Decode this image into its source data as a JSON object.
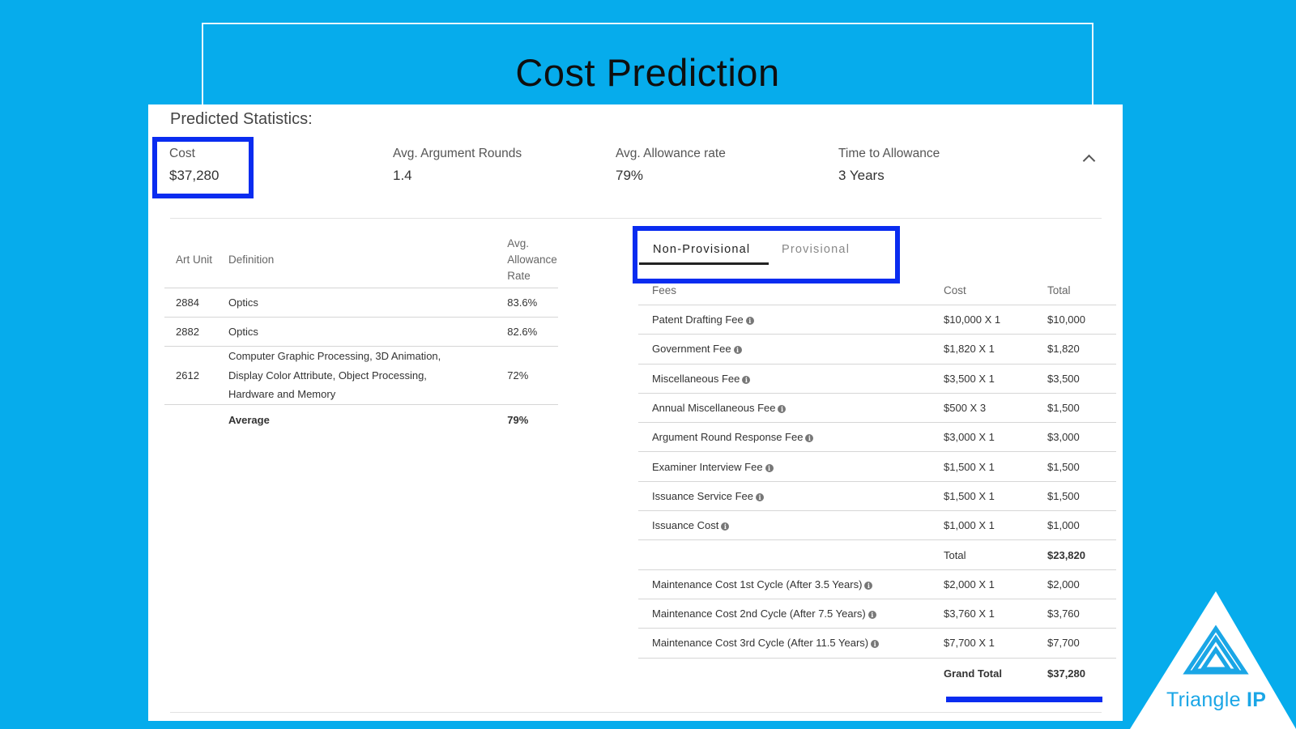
{
  "title": "Cost Prediction",
  "predicted_label": "Predicted Statistics:",
  "stats": [
    {
      "label": "Cost",
      "value": "$37,280"
    },
    {
      "label": "Avg. Argument Rounds",
      "value": "1.4"
    },
    {
      "label": "Avg. Allowance rate",
      "value": "79%"
    },
    {
      "label": "Time to Allowance",
      "value": "3 Years"
    }
  ],
  "art_units": {
    "headers": [
      "Art Unit",
      "Definition",
      "Avg. Allowance Rate"
    ],
    "rows": [
      {
        "unit": "2884",
        "definition": "Optics",
        "rate": "83.6%"
      },
      {
        "unit": "2882",
        "definition": "Optics",
        "rate": "82.6%"
      },
      {
        "unit": "2612",
        "definition": "Computer Graphic Processing, 3D Animation, Display Color Attribute, Object Processing, Hardware and Memory",
        "rate": "72%"
      }
    ],
    "average_label": "Average",
    "average_value": "79%"
  },
  "tabs": [
    "Non-Provisional",
    "Provisional"
  ],
  "fees": {
    "headers": [
      "Fees",
      "Cost",
      "Total"
    ],
    "rows": [
      {
        "name": "Patent Drafting Fee",
        "cost": "$10,000 X 1",
        "total": "$10,000"
      },
      {
        "name": "Government Fee",
        "cost": "$1,820 X 1",
        "total": "$1,820"
      },
      {
        "name": "Miscellaneous Fee",
        "cost": "$3,500 X 1",
        "total": "$3,500"
      },
      {
        "name": "Annual Miscellaneous Fee",
        "cost": "$500 X 3",
        "total": "$1,500"
      },
      {
        "name": "Argument Round Response Fee",
        "cost": "$3,000 X 1",
        "total": "$3,000"
      },
      {
        "name": "Examiner Interview Fee",
        "cost": "$1,500 X 1",
        "total": "$1,500"
      },
      {
        "name": "Issuance Service Fee",
        "cost": "$1,500 X 1",
        "total": "$1,500"
      },
      {
        "name": "Issuance Cost",
        "cost": "$1,000 X 1",
        "total": "$1,000"
      }
    ],
    "subtotal_label": "Total",
    "subtotal_value": "$23,820",
    "maintenance": [
      {
        "name": "Maintenance Cost 1st Cycle (After 3.5 Years)",
        "cost": "$2,000 X 1",
        "total": "$2,000"
      },
      {
        "name": "Maintenance Cost 2nd Cycle (After 7.5 Years)",
        "cost": "$3,760 X 1",
        "total": "$3,760"
      },
      {
        "name": "Maintenance Cost 3rd Cycle (After 11.5 Years)",
        "cost": "$7,700 X 1",
        "total": "$7,700"
      }
    ],
    "grand_total_label": "Grand Total",
    "grand_total_value": "$37,280"
  },
  "info_glyph": "i",
  "logo": {
    "brand_word": "Triangle",
    "brand_suffix": "IP",
    "color": "#1aa6e6"
  },
  "colors": {
    "background": "#06acec",
    "highlight": "#0a2cf0"
  }
}
